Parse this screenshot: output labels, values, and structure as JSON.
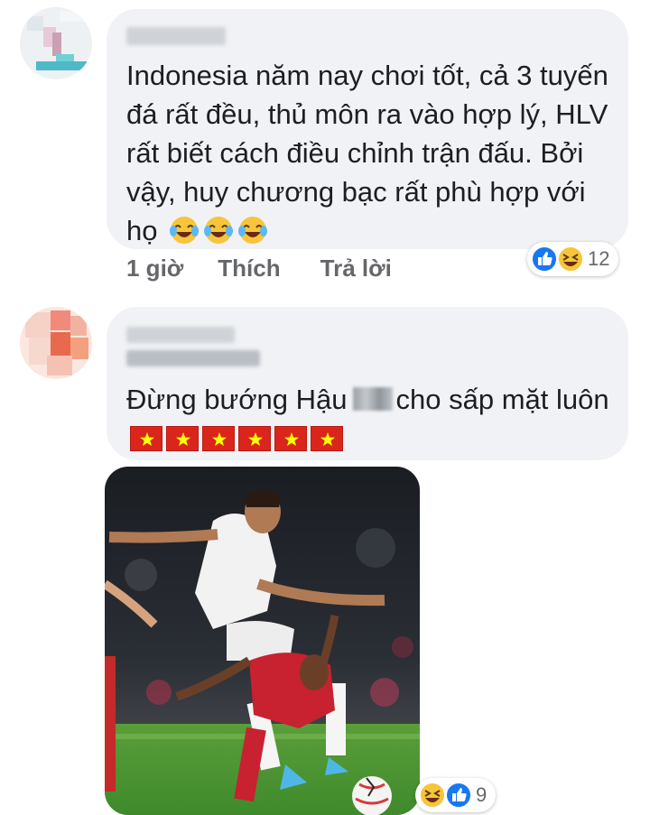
{
  "comments": [
    {
      "author": "",
      "text": "Indonesia năm nay chơi tốt, cả 3 tuyến đá rất đều, thủ môn ra vào hợp lý, HLV rất biết cách điều chỉnh trận đấu. Bởi vậy, huy chương bạc rất phù hợp với họ",
      "emojis": [
        "laughing-tears",
        "laughing-tears",
        "laughing-tears"
      ],
      "time": "1 giờ",
      "like_label": "Thích",
      "reply_label": "Trả lời",
      "reactions": [
        "like",
        "haha"
      ],
      "reaction_count": "12"
    },
    {
      "author": "",
      "text_before": "Đừng bướng Hậu",
      "text_after": "cho sấp mặt luôn",
      "flags": [
        "vietnam-flag",
        "vietnam-flag",
        "vietnam-flag",
        "vietnam-flag",
        "vietnam-flag",
        "vietnam-flag"
      ],
      "photo": "football-players-photo",
      "reactions": [
        "haha",
        "like"
      ],
      "reaction_count": "9"
    }
  ],
  "colors": {
    "bubble": "#f0f2f5",
    "action_text": "#65676b",
    "like_blue": "#1877f2",
    "flag_red": "#da251d",
    "flag_star": "#ffff00"
  }
}
